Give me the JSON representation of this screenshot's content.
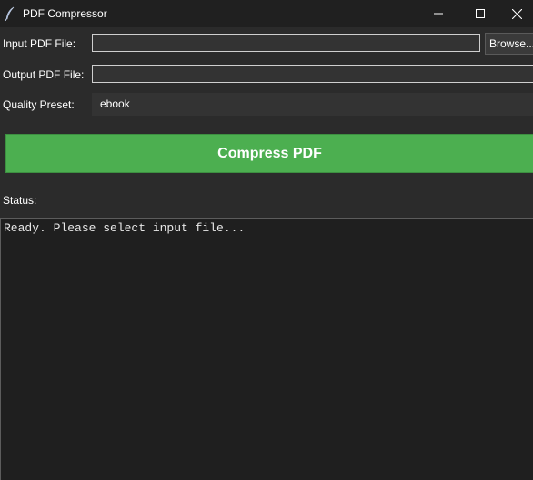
{
  "window": {
    "title": "PDF Compressor",
    "icon": "feather-icon"
  },
  "form": {
    "input_label": "Input PDF File:",
    "input_value": "",
    "browse_label": "Browse...",
    "output_label": "Output PDF File:",
    "output_value": "",
    "preset_label": "Quality Preset:",
    "preset_value": "ebook"
  },
  "actions": {
    "compress_label": "Compress PDF"
  },
  "status": {
    "label": "Status:",
    "log": "Ready. Please select input file..."
  },
  "colors": {
    "compress_button": "#4caf50",
    "background": "#2b2b2b",
    "titlebar": "#202020"
  }
}
